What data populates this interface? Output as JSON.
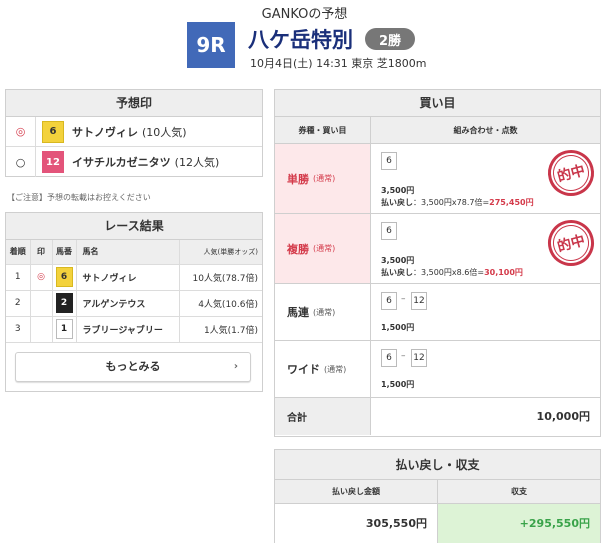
{
  "header": {
    "title": "GANKOの予想",
    "race_number": "9R",
    "race_name": "八ケ岳特別",
    "grade": "2勝",
    "meta": "10月4日(土) 14:31 東京 芝1800m"
  },
  "prediction": {
    "heading": "予想印",
    "rows": [
      {
        "mark": "◎",
        "number": "6",
        "horse": "サトノヴィレ",
        "popularity": "(10人気)"
      },
      {
        "mark": "○",
        "number": "12",
        "horse": "イサチルカゼニタツ",
        "popularity": "(12人気)"
      }
    ],
    "note": "【ご注意】予想の転載はお控えください"
  },
  "result": {
    "heading": "レース結果",
    "columns": [
      "着順",
      "印",
      "馬番",
      "馬名",
      "人気(単勝オッズ)"
    ],
    "rows": [
      {
        "pos": "1",
        "mark": "◎",
        "number": "6",
        "horse": "サトノヴィレ",
        "popularity": "10人気(78.7倍)"
      },
      {
        "pos": "2",
        "mark": "",
        "number": "2",
        "horse": "アルゲンテウス",
        "popularity": "4人気(10.6倍)"
      },
      {
        "pos": "3",
        "mark": "",
        "number": "1",
        "horse": "ラブリージャブリー",
        "popularity": "1人気(1.7倍)"
      }
    ],
    "more_label": "もっとみる"
  },
  "bets": {
    "heading": "買い目",
    "col1": "券種・買い目",
    "col2": "組み合わせ・点数",
    "rows": [
      {
        "type": "単勝",
        "kind": "(通常)",
        "hit": true,
        "combo": [
          "6"
        ],
        "amount": "3,500円",
        "payback_label": "払い戻し",
        "payback_calc": "：3,500円x78.7倍=",
        "payback_value": "275,450円",
        "stamp": "的中"
      },
      {
        "type": "複勝",
        "kind": "(通常)",
        "hit": true,
        "combo": [
          "6"
        ],
        "amount": "3,500円",
        "payback_label": "払い戻し",
        "payback_calc": "：3,500円x8.6倍=",
        "payback_value": "30,100円",
        "stamp": "的中"
      },
      {
        "type": "馬連",
        "kind": "(通常)",
        "hit": false,
        "combo": [
          "6",
          "12"
        ],
        "amount": "1,500円"
      },
      {
        "type": "ワイド",
        "kind": "(通常)",
        "hit": false,
        "combo": [
          "6",
          "12"
        ],
        "amount": "1,500円"
      }
    ],
    "total_label": "合計",
    "total_value": "10,000円"
  },
  "payout": {
    "heading": "払い戻し・収支",
    "payback_label": "払い戻し金額",
    "balance_label": "収支",
    "payback_value": "305,550円",
    "balance_value": "+295,550円"
  }
}
